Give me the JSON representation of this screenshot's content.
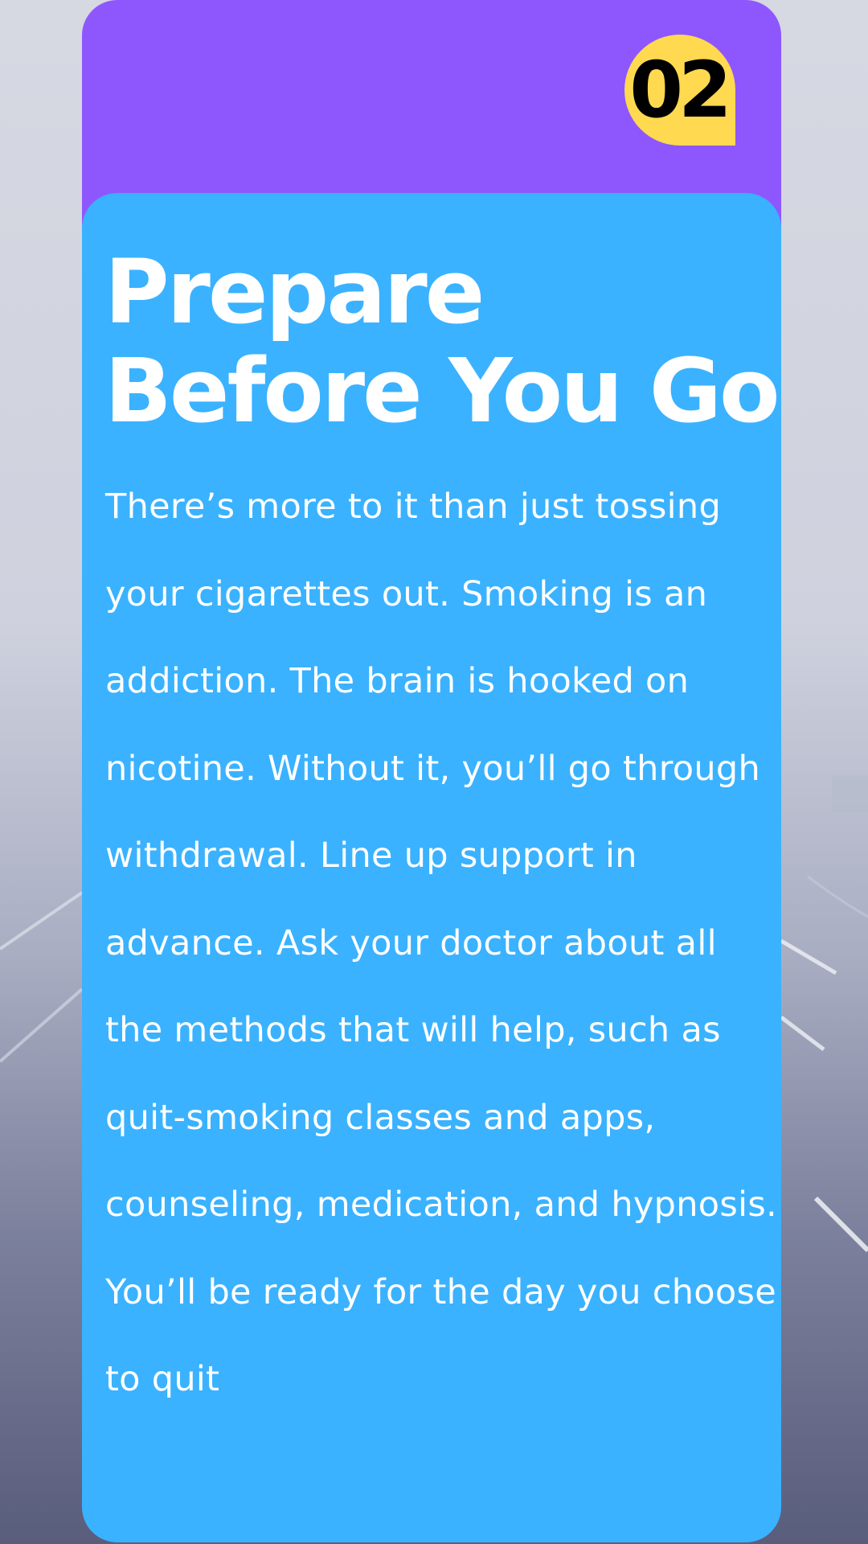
{
  "badge": {
    "number": "02"
  },
  "heading": {
    "line1": "Prepare",
    "line2": "Before You Go"
  },
  "body": {
    "text": "There’s more to it than just tossing your cigarettes out. Smoking is an addiction. The brain is hooked on nicotine. Without it, you’ll go through withdrawal. Line up support in advance. Ask your doctor about all the methods that will help, such as quit-smoking classes and apps, counseling, medication, and hypnosis. You’ll be ready for the day you choose to quit"
  },
  "colors": {
    "header_purple": "#8e57fe",
    "card_blue": "#3ab2ff",
    "badge_yellow": "#ffd94f",
    "text_white": "#ffffff"
  }
}
